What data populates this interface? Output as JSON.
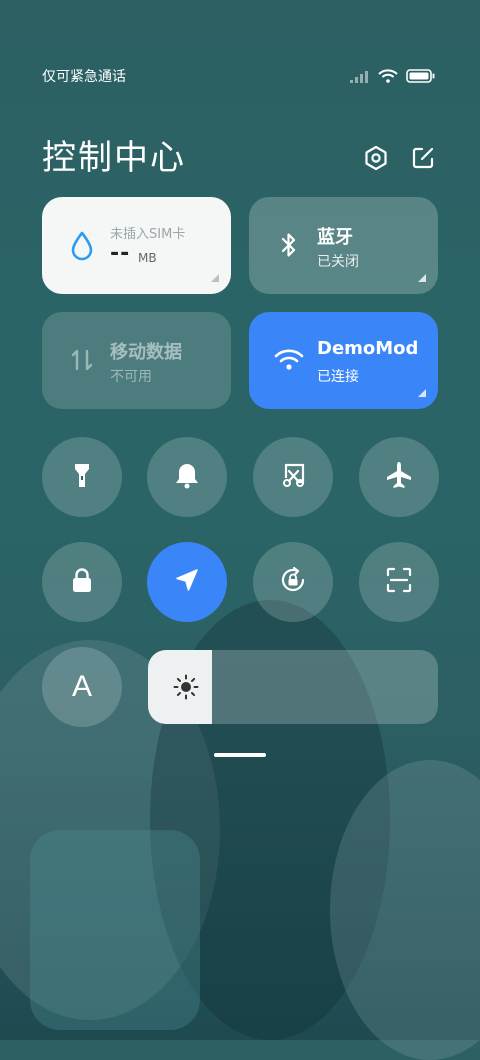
{
  "status": {
    "carrier": "仅可紧急通话",
    "icons": [
      "signal-icon",
      "wifi-icon",
      "battery-icon"
    ]
  },
  "header": {
    "title": "控制中心",
    "settings_icon": "settings-icon",
    "edit_icon": "edit-icon"
  },
  "cards": {
    "data_usage": {
      "label": "未插入SIM卡",
      "value": "--",
      "unit": "MB"
    },
    "bluetooth": {
      "name": "蓝牙",
      "status": "已关闭"
    },
    "mobile_data": {
      "name": "移动数据",
      "status": "不可用"
    },
    "wifi": {
      "name": "DemoMod",
      "status": "已连接"
    }
  },
  "toggles": [
    {
      "icon": "flashlight-icon",
      "active": false
    },
    {
      "icon": "bell-icon",
      "active": false
    },
    {
      "icon": "screenshot-icon",
      "active": false
    },
    {
      "icon": "airplane-icon",
      "active": false
    },
    {
      "icon": "lock-icon",
      "active": false
    },
    {
      "icon": "location-icon",
      "active": true
    },
    {
      "icon": "rotation-lock-icon",
      "active": false
    },
    {
      "icon": "scanner-icon",
      "active": false
    }
  ],
  "font_button": {
    "label": "A"
  },
  "brightness": {
    "level": 0.22
  },
  "colors": {
    "accent": "#3a86f8",
    "card_white": "#f5f7f7",
    "tile_translucent": "rgba(255,255,255,0.18)"
  }
}
